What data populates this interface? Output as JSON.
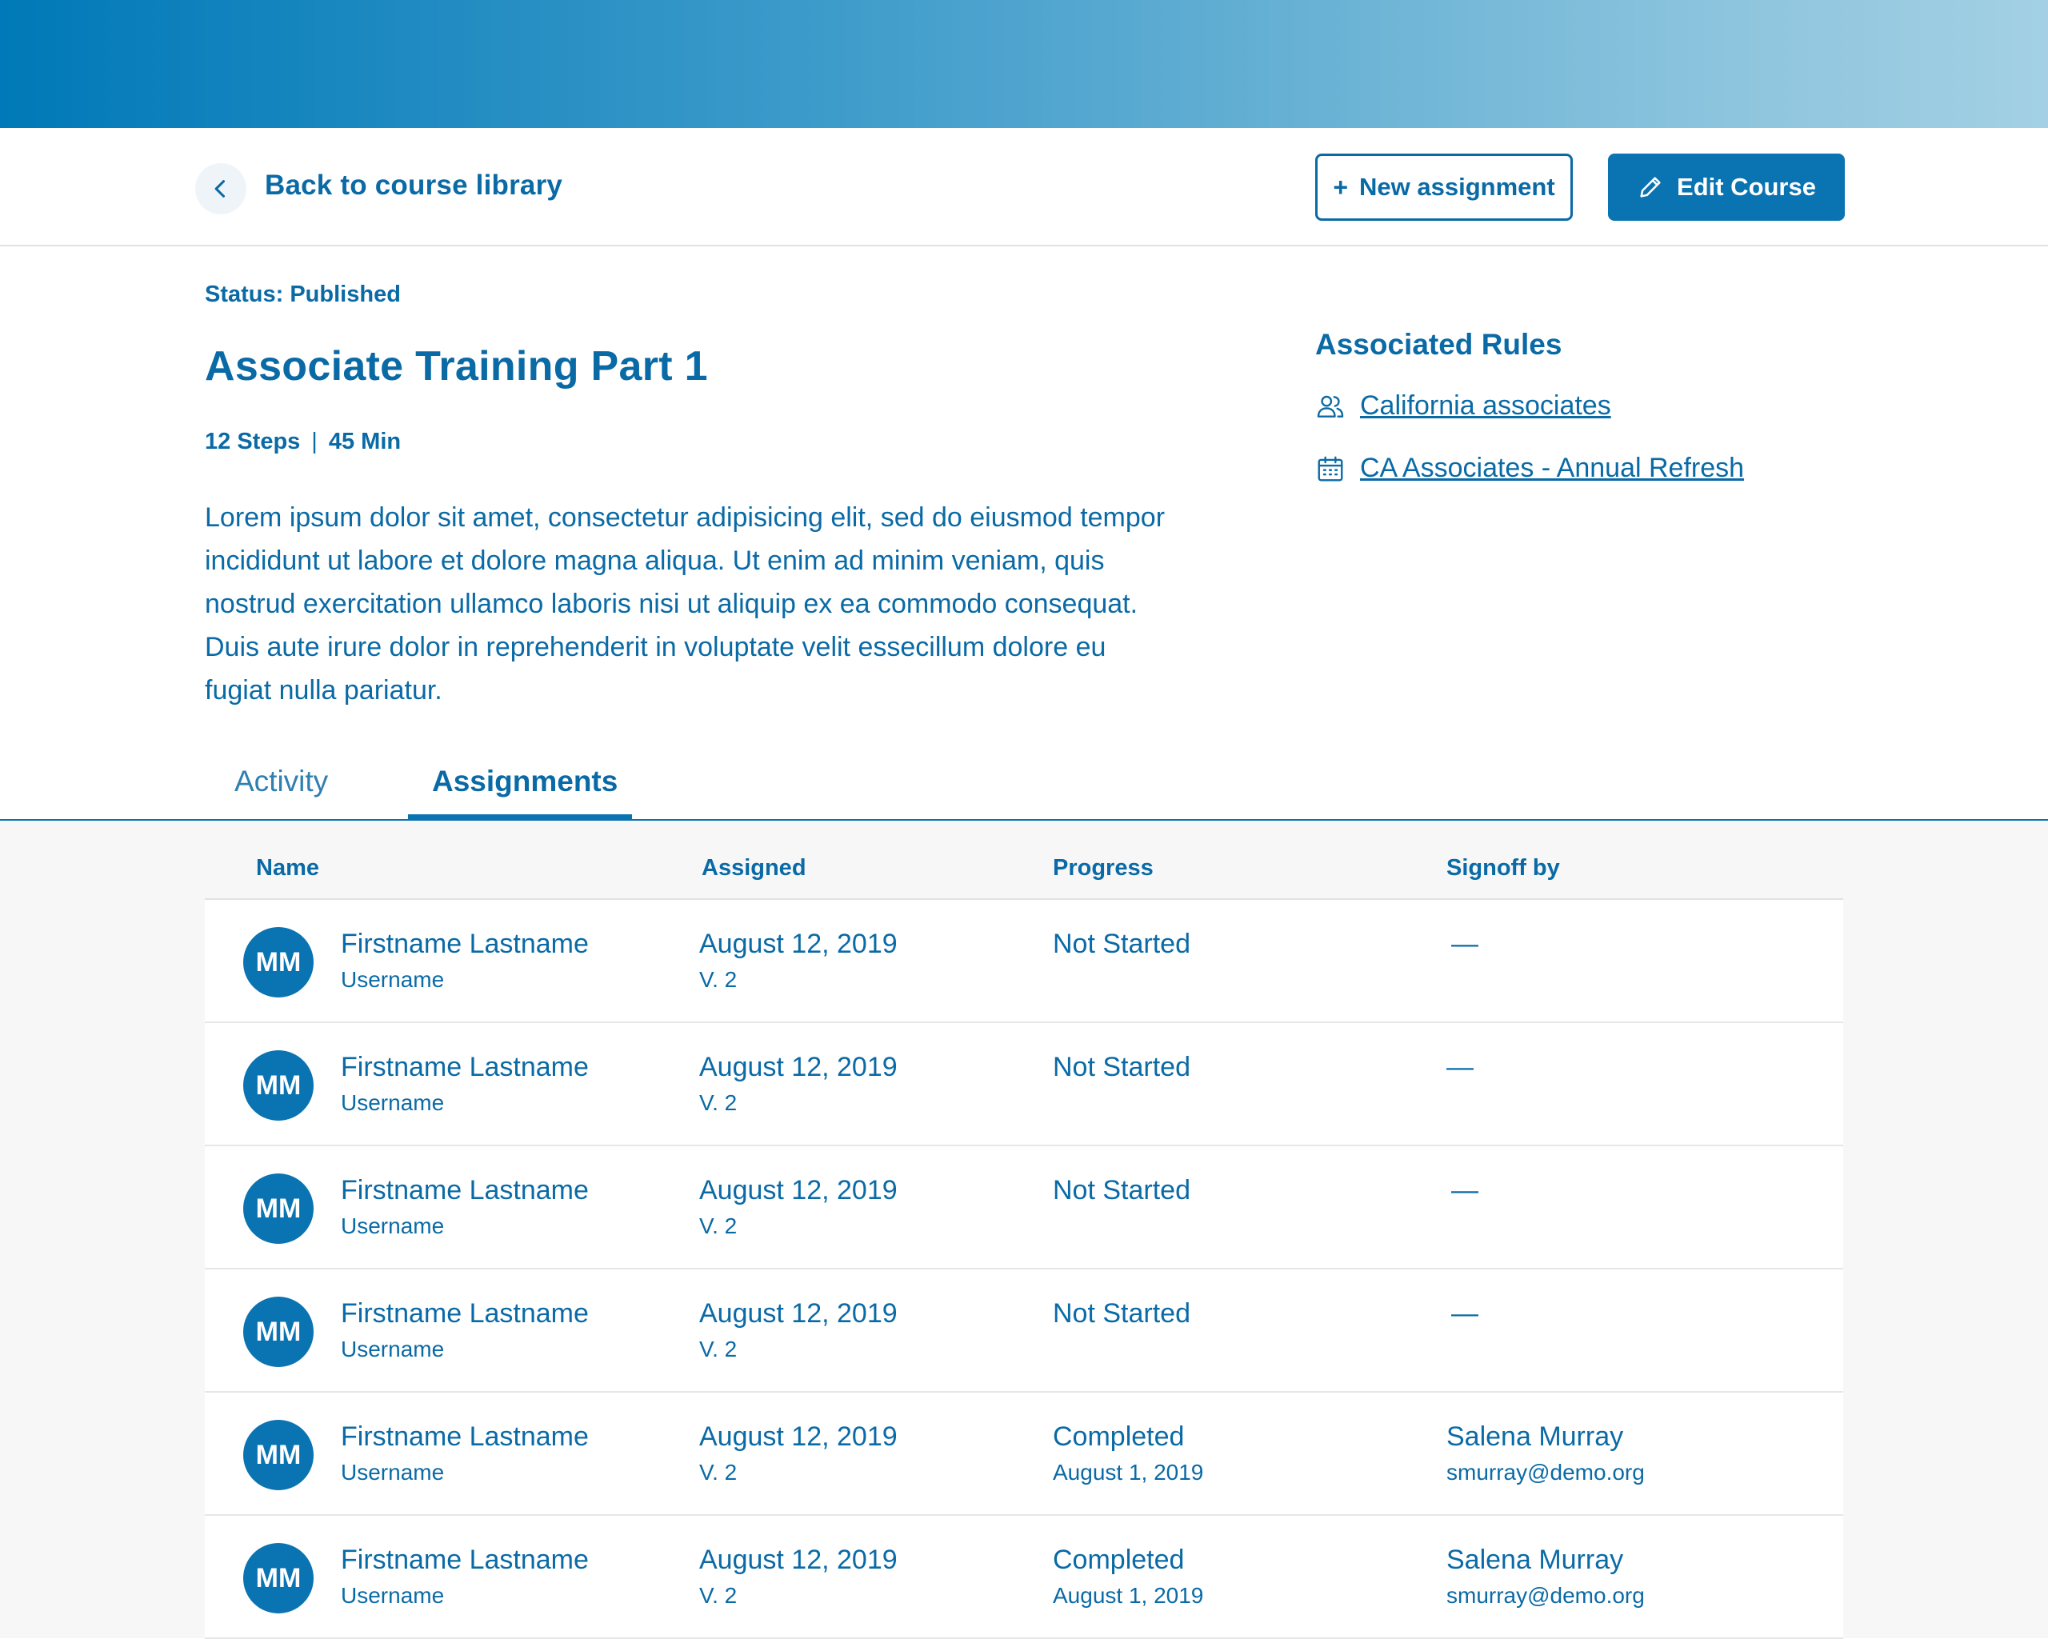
{
  "topbar": {
    "back_label": "Back to course library",
    "new_assignment_label": "New assignment",
    "edit_course_label": "Edit Course"
  },
  "course": {
    "status": "Status: Published",
    "title": "Associate Training Part 1",
    "steps": "12 Steps",
    "duration": "45 Min",
    "description": " Lorem ipsum dolor sit amet, consectetur adipisicing elit, sed do eiusmod tempor incididunt ut labore et dolore magna aliqua. Ut enim ad minim veniam, quis nostrud exercitation ullamco laboris nisi ut aliquip ex ea commodo consequat. Duis aute irure dolor in reprehenderit in voluptate velit essecillum dolore eu fugiat nulla pariatur."
  },
  "rules": {
    "title": "Associated Rules",
    "items": [
      {
        "label": "California associates",
        "icon": "users-icon"
      },
      {
        "label": "CA Associates - Annual Refresh",
        "icon": "calendar-icon"
      }
    ]
  },
  "tabs": [
    {
      "label": "Activity",
      "active": false
    },
    {
      "label": "Assignments",
      "active": true
    }
  ],
  "table": {
    "headers": [
      "Name",
      "Assigned",
      "Progress",
      "Signoff by"
    ],
    "rows": [
      {
        "initials": "MM",
        "name": "Firstname Lastname",
        "username": "Username",
        "assigned": "August 12, 2019",
        "version": "V. 2",
        "progress": "Not Started",
        "progress_date": "",
        "signoff_name": "—",
        "signoff_email": ""
      },
      {
        "initials": "MM",
        "name": "Firstname Lastname",
        "username": "Username",
        "assigned": "August 12, 2019",
        "version": "V. 2",
        "progress": "Not Started",
        "progress_date": "",
        "signoff_name": "—",
        "signoff_email": ""
      },
      {
        "initials": "MM",
        "name": "Firstname Lastname",
        "username": "Username",
        "assigned": "August 12, 2019",
        "version": "V. 2",
        "progress": "Not Started",
        "progress_date": "",
        "signoff_name": "—",
        "signoff_email": ""
      },
      {
        "initials": "MM",
        "name": "Firstname Lastname",
        "username": "Username",
        "assigned": "August 12, 2019",
        "version": "V. 2",
        "progress": "Not Started",
        "progress_date": "",
        "signoff_name": "—",
        "signoff_email": ""
      },
      {
        "initials": "MM",
        "name": "Firstname Lastname",
        "username": "Username",
        "assigned": "August 12, 2019",
        "version": "V. 2",
        "progress": "Completed",
        "progress_date": "August 1, 2019",
        "signoff_name": "Salena Murray",
        "signoff_email": "smurray@demo.org"
      },
      {
        "initials": "MM",
        "name": "Firstname Lastname",
        "username": "Username",
        "assigned": "August 12, 2019",
        "version": "V. 2",
        "progress": "Completed",
        "progress_date": "August 1, 2019",
        "signoff_name": "Salena Murray",
        "signoff_email": "smurray@demo.org"
      }
    ]
  },
  "colors": {
    "primary": "#0a73b1",
    "text": "#0a6aa6",
    "table_background": "#f7f7f7"
  }
}
